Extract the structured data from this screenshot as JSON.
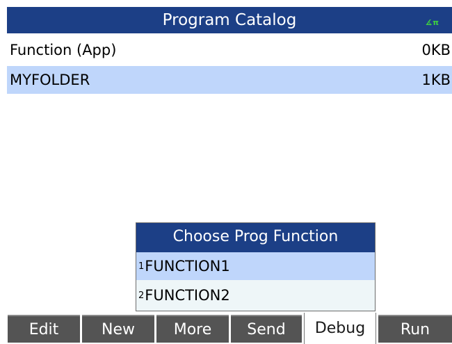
{
  "header": {
    "title": "Program Catalog",
    "angle_indicator": "∡π"
  },
  "catalog": {
    "items": [
      {
        "name": "Function (App)",
        "size": "0KB",
        "selected": false
      },
      {
        "name": "MYFOLDER",
        "size": "1KB",
        "selected": true
      }
    ]
  },
  "popup": {
    "title": "Choose Prog Function",
    "items": [
      {
        "index": "1",
        "label": "FUNCTION1",
        "selected": true
      },
      {
        "index": "2",
        "label": "FUNCTION2",
        "selected": false
      }
    ]
  },
  "softkeys": [
    {
      "label": "Edit"
    },
    {
      "label": "New"
    },
    {
      "label": "More"
    },
    {
      "label": "Send"
    },
    {
      "label": "Debug",
      "active": true
    },
    {
      "label": "Run"
    }
  ],
  "colors": {
    "titlebar": "#1c3f86",
    "selection": "#bfd6fb",
    "popup_bg": "#eef6f8",
    "softkey_bg": "#545454",
    "angle_indicator": "#3fd23f"
  }
}
